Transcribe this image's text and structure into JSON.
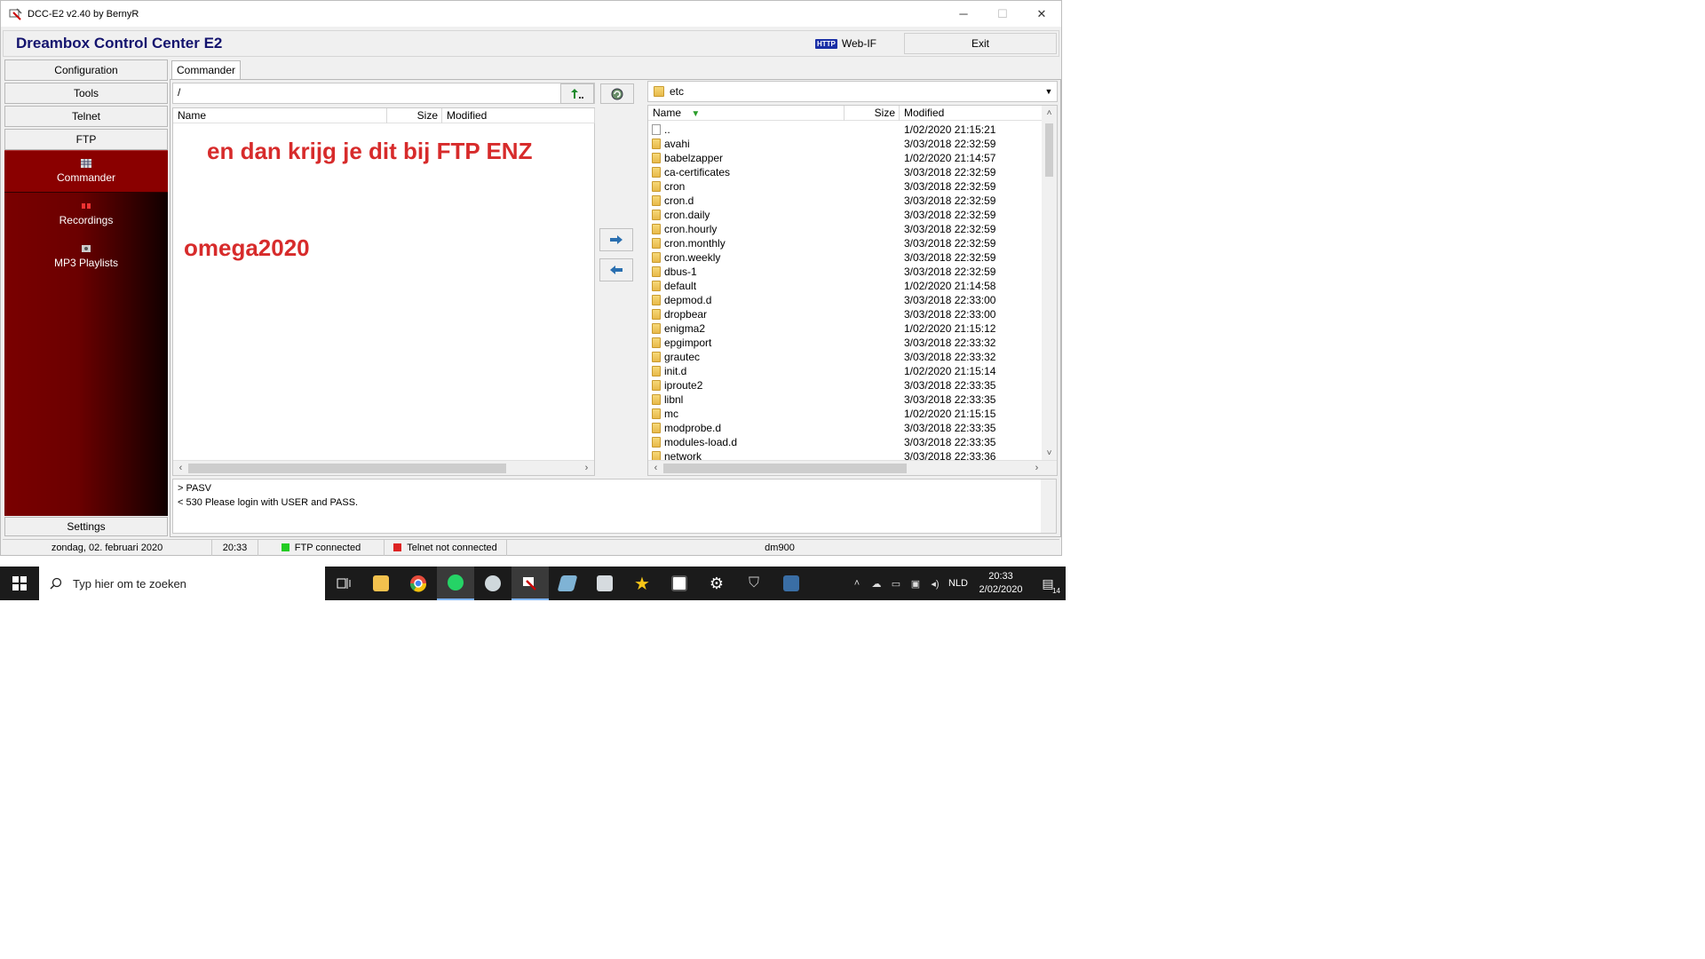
{
  "window": {
    "title": "DCC-E2 v2.40 by BernyR",
    "controls": {
      "minimize": "─",
      "maximize": "☐",
      "close": "✕"
    }
  },
  "header": {
    "brand": "Dreambox Control Center E2",
    "webif_badge": "HTTP",
    "webif_label": "Web-IF",
    "exit_label": "Exit"
  },
  "sidebar": {
    "buttons": [
      "Configuration",
      "Tools",
      "Telnet",
      "FTP"
    ],
    "items": [
      {
        "label": "Commander",
        "icon": "grid-icon"
      },
      {
        "label": "Recordings",
        "icon": "film-icon"
      },
      {
        "label": "MP3 Playlists",
        "icon": "music-icon"
      }
    ],
    "settings_label": "Settings"
  },
  "tab": {
    "label": "Commander"
  },
  "left_panel": {
    "path": "/",
    "columns": [
      "Name",
      "Size",
      "Modified"
    ],
    "overlay_text_1": "en dan krijg je dit bij FTP ENZ",
    "overlay_text_2": "omega2020"
  },
  "right_panel": {
    "path": "etc",
    "columns": [
      "Name",
      "Size",
      "Modified"
    ],
    "rows": [
      {
        "name": "..",
        "date": "1/02/2020 21:15:21",
        "type": "file"
      },
      {
        "name": "avahi",
        "date": "3/03/2018 22:32:59",
        "type": "folder"
      },
      {
        "name": "babelzapper",
        "date": "1/02/2020 21:14:57",
        "type": "folder"
      },
      {
        "name": "ca-certificates",
        "date": "3/03/2018 22:32:59",
        "type": "folder"
      },
      {
        "name": "cron",
        "date": "3/03/2018 22:32:59",
        "type": "folder"
      },
      {
        "name": "cron.d",
        "date": "3/03/2018 22:32:59",
        "type": "folder"
      },
      {
        "name": "cron.daily",
        "date": "3/03/2018 22:32:59",
        "type": "folder"
      },
      {
        "name": "cron.hourly",
        "date": "3/03/2018 22:32:59",
        "type": "folder"
      },
      {
        "name": "cron.monthly",
        "date": "3/03/2018 22:32:59",
        "type": "folder"
      },
      {
        "name": "cron.weekly",
        "date": "3/03/2018 22:32:59",
        "type": "folder"
      },
      {
        "name": "dbus-1",
        "date": "3/03/2018 22:32:59",
        "type": "folder"
      },
      {
        "name": "default",
        "date": "1/02/2020 21:14:58",
        "type": "folder"
      },
      {
        "name": "depmod.d",
        "date": "3/03/2018 22:33:00",
        "type": "folder"
      },
      {
        "name": "dropbear",
        "date": "3/03/2018 22:33:00",
        "type": "folder"
      },
      {
        "name": "enigma2",
        "date": "1/02/2020 21:15:12",
        "type": "folder"
      },
      {
        "name": "epgimport",
        "date": "3/03/2018 22:33:32",
        "type": "folder"
      },
      {
        "name": "grautec",
        "date": "3/03/2018 22:33:32",
        "type": "folder"
      },
      {
        "name": "init.d",
        "date": "1/02/2020 21:15:14",
        "type": "folder"
      },
      {
        "name": "iproute2",
        "date": "3/03/2018 22:33:35",
        "type": "folder"
      },
      {
        "name": "libnl",
        "date": "3/03/2018 22:33:35",
        "type": "folder"
      },
      {
        "name": "mc",
        "date": "1/02/2020 21:15:15",
        "type": "folder"
      },
      {
        "name": "modprobe.d",
        "date": "3/03/2018 22:33:35",
        "type": "folder"
      },
      {
        "name": "modules-load.d",
        "date": "3/03/2018 22:33:35",
        "type": "folder"
      },
      {
        "name": "network",
        "date": "3/03/2018 22:33:36",
        "type": "folder"
      }
    ]
  },
  "log": {
    "lines": [
      "> PASV",
      "< 530 Please login with USER and PASS."
    ]
  },
  "status": {
    "date": "zondag, 02. februari 2020",
    "time": "20:33",
    "ftp": "FTP connected",
    "telnet": "Telnet not connected",
    "device": "dm900",
    "ftp_color": "#22cc22",
    "telnet_color": "#dd2222"
  },
  "taskbar": {
    "search_placeholder": "Typ hier om te zoeken",
    "language": "NLD",
    "clock_time": "20:33",
    "clock_date": "2/02/2020",
    "notifications": "14"
  }
}
